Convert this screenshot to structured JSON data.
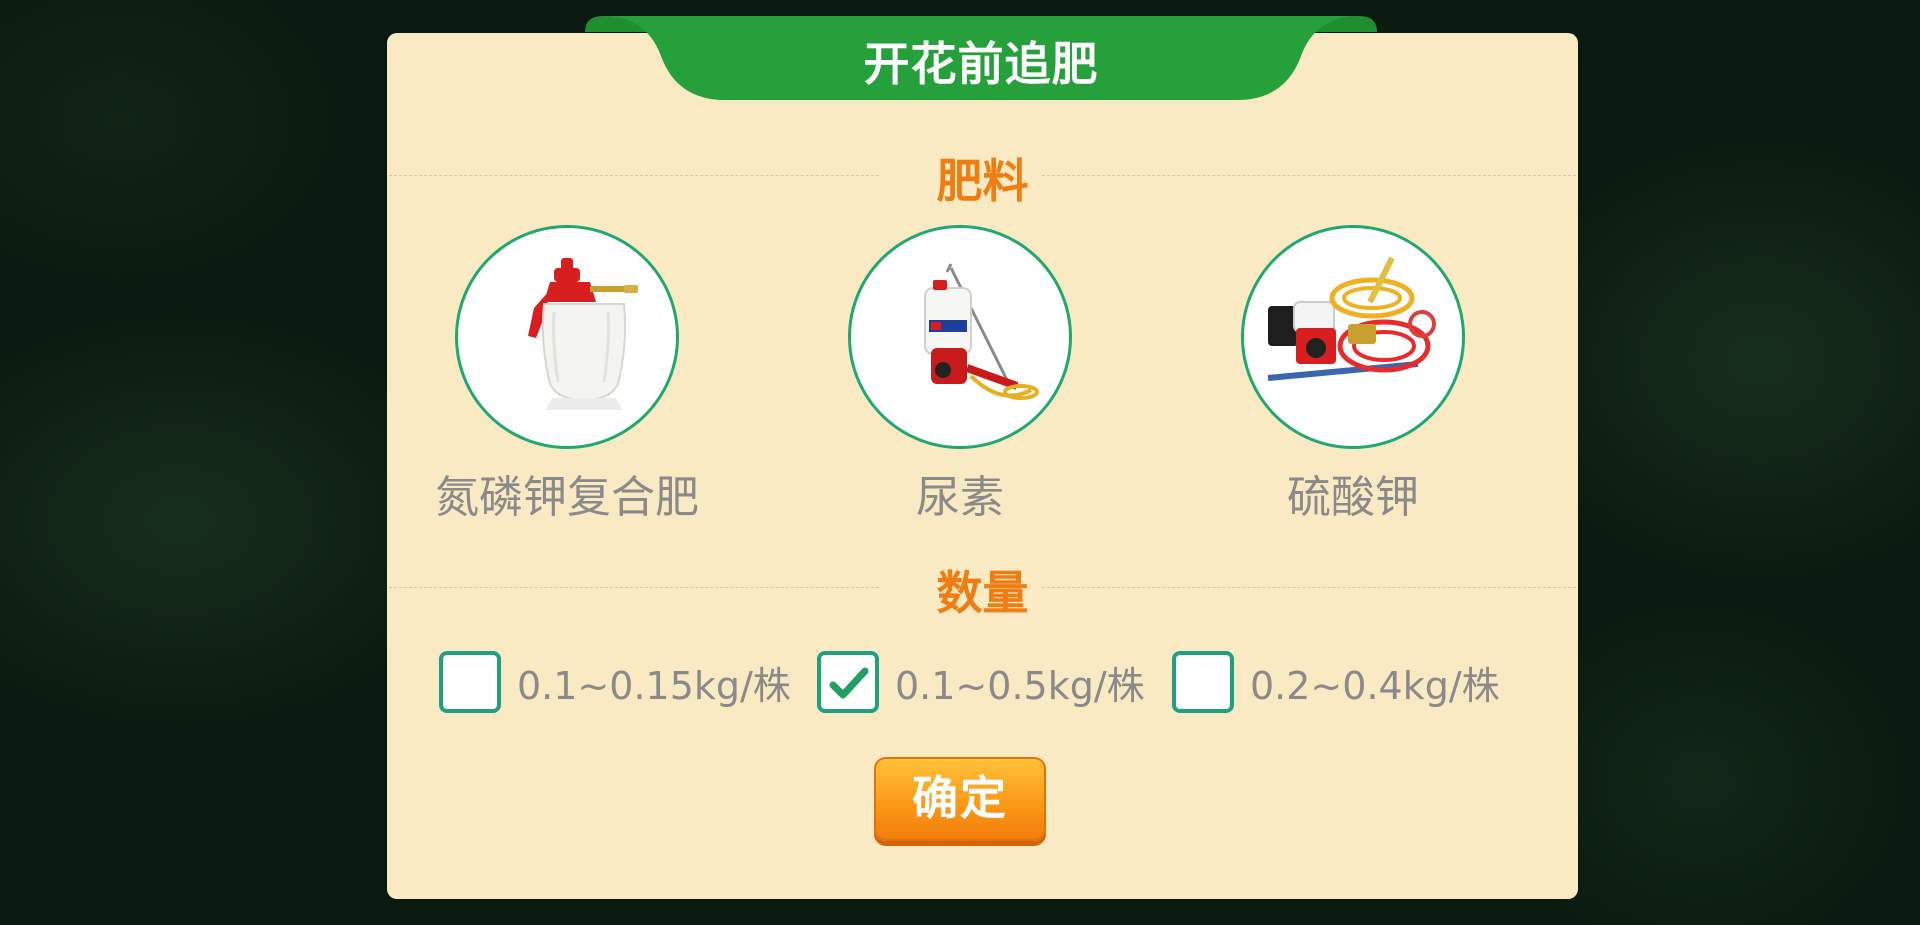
{
  "dialog": {
    "title": "开花前追肥",
    "fertilizer_section_label": "肥料",
    "quantity_section_label": "数量",
    "confirm_label": "确定"
  },
  "fertilizers": [
    {
      "label": "氮磷钾复合肥",
      "image": "hand-pump-sprayer"
    },
    {
      "label": "尿素",
      "image": "backpack-sprayer"
    },
    {
      "label": "硫酸钾",
      "image": "engine-power-sprayer"
    }
  ],
  "quantities": [
    {
      "label": "0.1~0.15kg/株",
      "checked": false
    },
    {
      "label": "0.1~0.5kg/株",
      "checked": true
    },
    {
      "label": "0.2~0.4kg/株",
      "checked": false
    }
  ],
  "colors": {
    "panel": "#f9eac4",
    "banner_green": "#26a03a",
    "accent_orange": "#f07d12",
    "circle_border": "#20a870",
    "checkbox_border": "#20a080",
    "button_orange": "#fb9a18"
  }
}
